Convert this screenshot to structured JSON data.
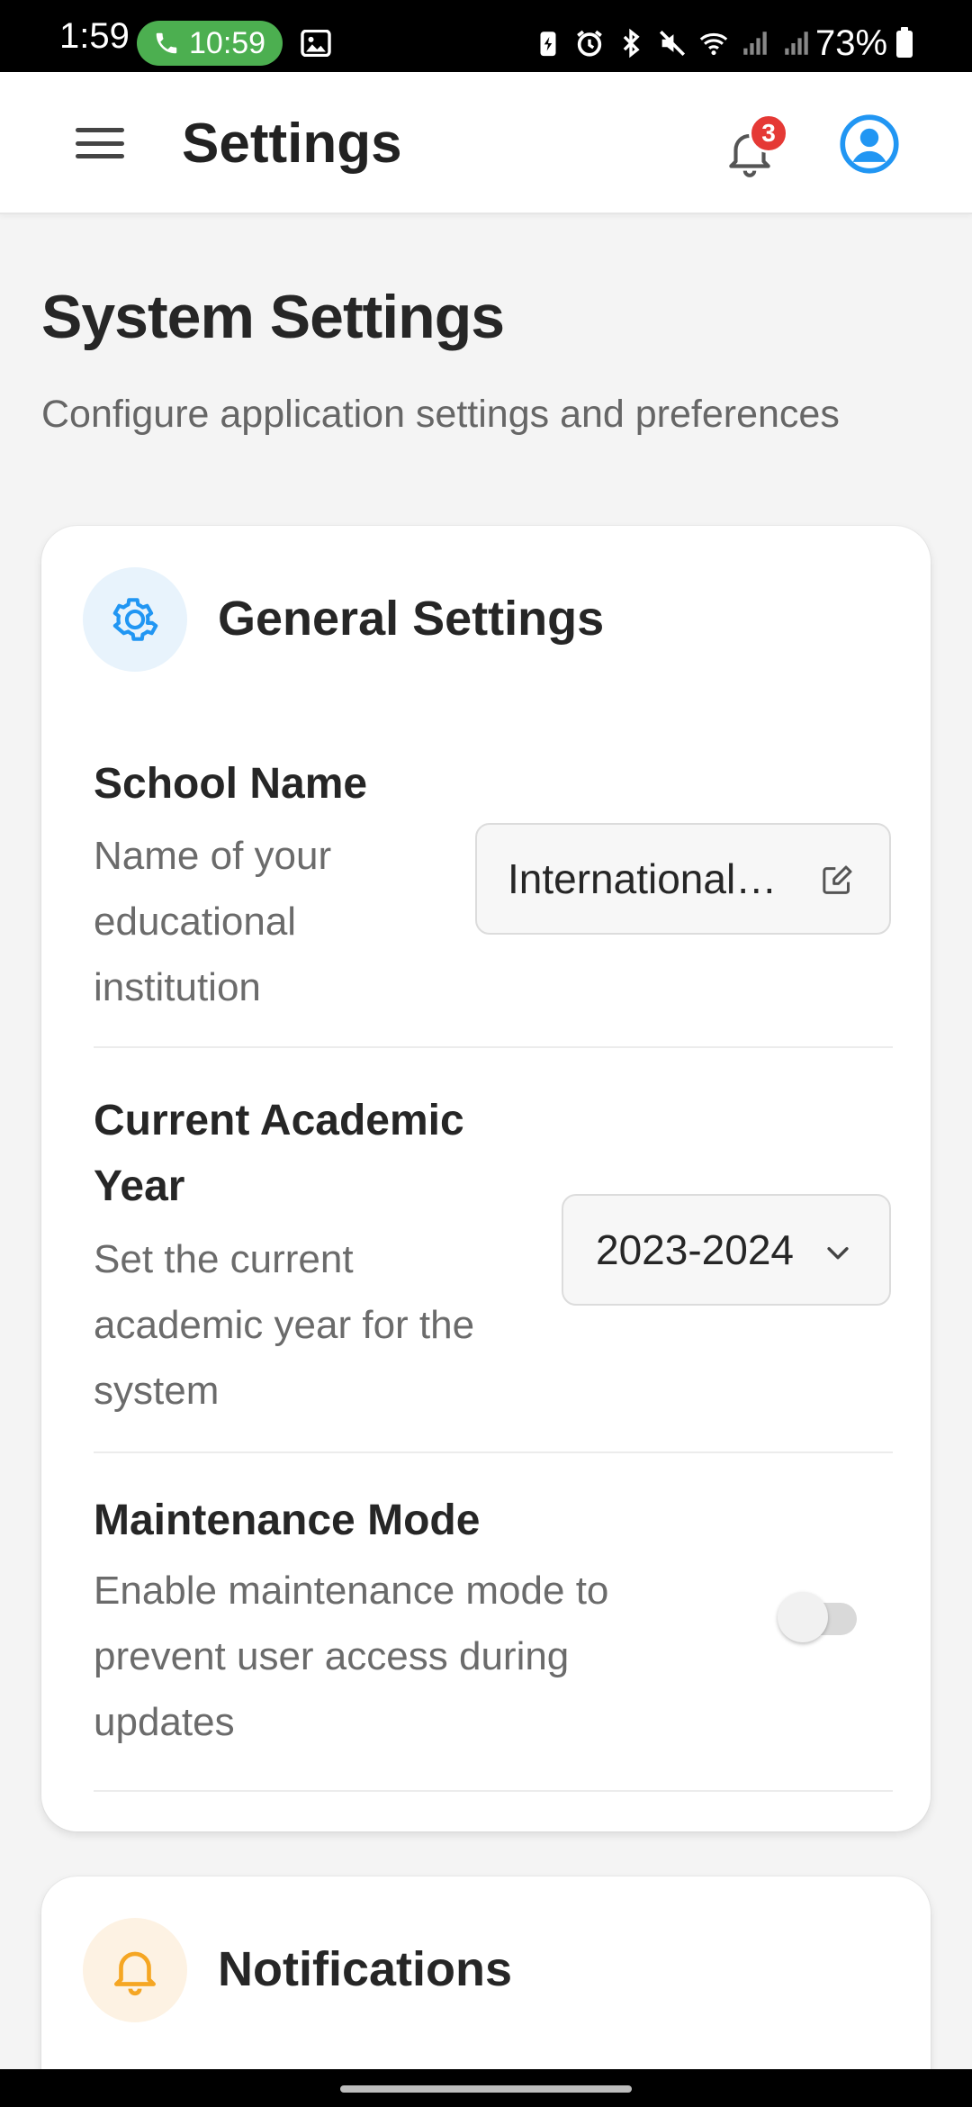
{
  "status_bar": {
    "time": "1:59",
    "call_time": "10:59",
    "battery": "73%"
  },
  "app_bar": {
    "title": "Settings",
    "notification_count": "3"
  },
  "page": {
    "title": "System Settings",
    "subtitle": "Configure application settings and preferences"
  },
  "general_settings": {
    "title": "General Settings",
    "icon": "gear-icon",
    "school_name": {
      "label": "School Name",
      "description": "Name of your educational institution",
      "value": "International School"
    },
    "academic_year": {
      "label": "Current Academic Year",
      "description": "Set the current academic year for the system",
      "value": "2023-2024"
    },
    "maintenance_mode": {
      "label": "Maintenance Mode",
      "description": "Enable maintenance mode to prevent user access during updates",
      "enabled": false
    }
  },
  "notifications": {
    "title": "Notifications",
    "icon": "bell-icon"
  },
  "colors": {
    "accent_blue": "#2196f3",
    "accent_orange": "#f5a623",
    "badge_red": "#e53935",
    "call_green": "#4caf50"
  }
}
